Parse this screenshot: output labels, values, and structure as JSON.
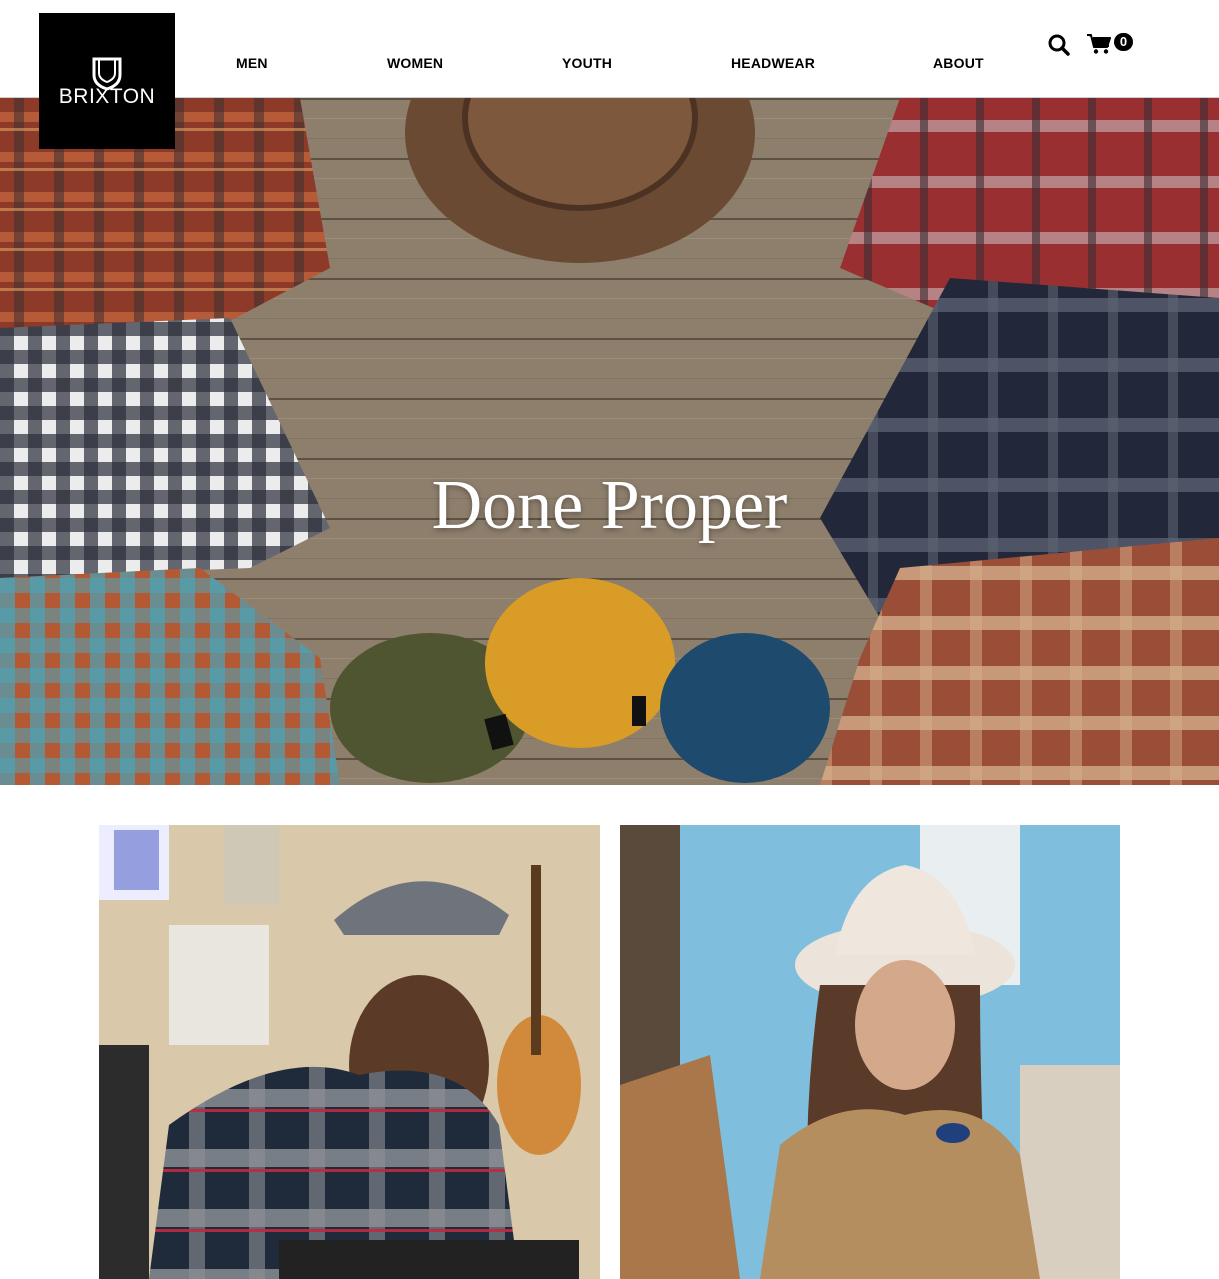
{
  "brand": {
    "logo_text": "BRIXTON"
  },
  "nav": {
    "items": [
      {
        "label": "MEN"
      },
      {
        "label": "WOMEN"
      },
      {
        "label": "YOUTH"
      },
      {
        "label": "HEADWEAR"
      },
      {
        "label": "ABOUT"
      }
    ]
  },
  "header": {
    "cart_count": "0",
    "icons": [
      "search-icon",
      "cart-icon"
    ]
  },
  "hero": {
    "title": "Done Proper",
    "image": "flannel-shirts-hats-beanies-on-wood"
  },
  "tiles": [
    {
      "image": "man-in-flat-cap-and-plaid-flannel"
    },
    {
      "image": "woman-in-white-fedora-and-corduroy-jacket"
    }
  ],
  "colors": {
    "header_bg": "#ffffff",
    "logo_bg": "#000000",
    "text": "#000000",
    "hero_title": "#ffffff"
  }
}
